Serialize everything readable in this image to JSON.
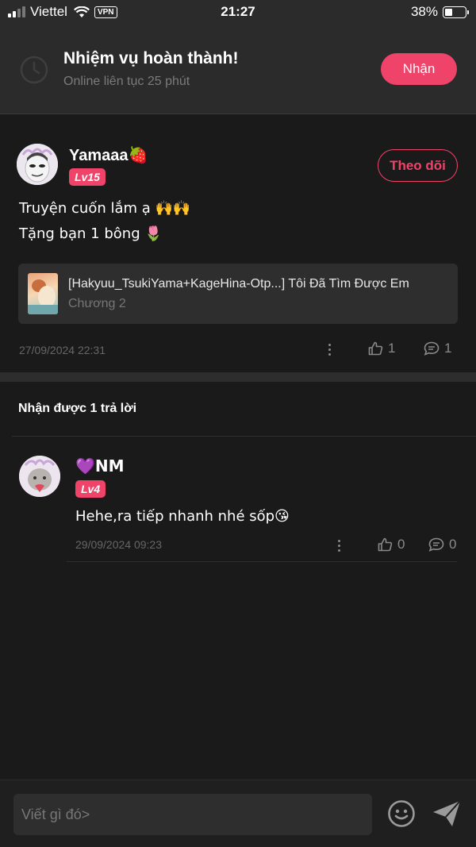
{
  "status_bar": {
    "carrier": "Viettel",
    "vpn": "VPN",
    "time": "21:27",
    "battery": "38%",
    "battery_level": 0.38
  },
  "task": {
    "title": "Nhiệm vụ hoàn thành!",
    "subtitle": "Online liên tục 25 phút",
    "claim_label": "Nhận"
  },
  "comment": {
    "username": "Yamaaa🍓",
    "level": "Lv15",
    "follow_label": "Theo dõi",
    "line1": "Truyện cuốn lắm ạ 🙌🙌",
    "line2": "Tặng bạn 1 bông 🌷",
    "story_title": "[Hakyuu_TsukiYama+KageHina-Otp...] Tôi Đã Tìm Được Em",
    "chapter": "Chương 2",
    "timestamp": "27/09/2024 22:31",
    "likes": "1",
    "replies": "1"
  },
  "replies_header": "Nhận được 1 trả lời",
  "reply": {
    "username": "💜NM",
    "level": "Lv4",
    "text": "Hehe,ra tiếp nhanh nhé sốp😘",
    "timestamp": "29/09/2024 09:23",
    "likes": "0",
    "replies": "0"
  },
  "composer": {
    "placeholder": "Viết gì đó>"
  },
  "colors": {
    "accent": "#f0436a",
    "background": "#1a1a1a",
    "panel": "#2b2b2b"
  }
}
